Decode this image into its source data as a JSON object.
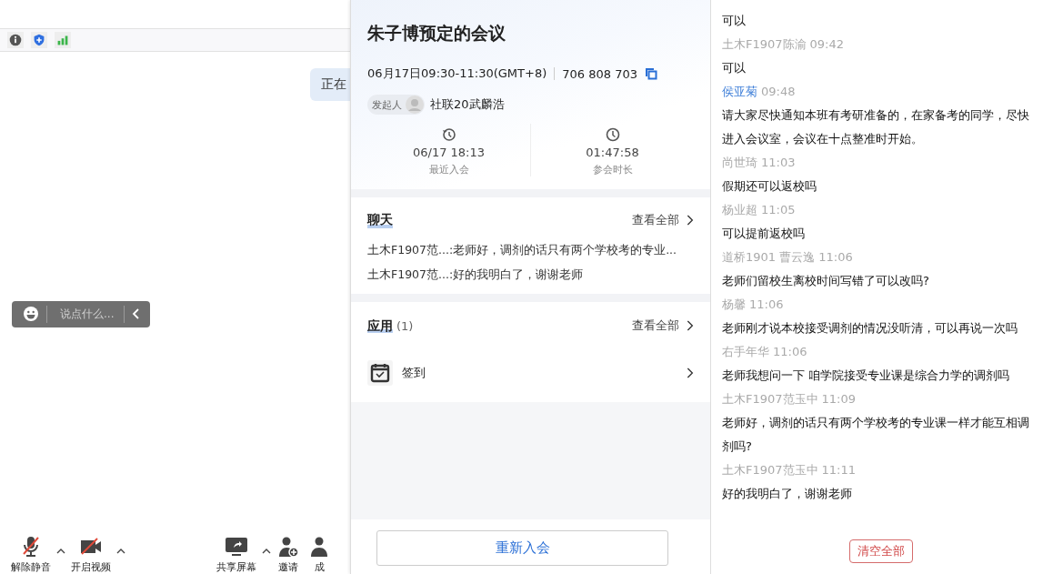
{
  "meeting_view": {
    "status_bubble": "正在",
    "chat_input": {
      "placeholder": "说点什么..."
    },
    "toolbar": [
      {
        "label": "解除静音",
        "kind": "mic",
        "caret": true
      },
      {
        "label": "开启视频",
        "kind": "video",
        "caret": true
      },
      {
        "label": "共享屏幕",
        "kind": "share",
        "caret": true
      },
      {
        "label": "邀请",
        "kind": "invite",
        "caret": false
      },
      {
        "label": "成",
        "kind": "members",
        "caret": false
      }
    ]
  },
  "meeting_panel": {
    "title": "朱子博预定的会议",
    "time": "06月17日09:30-11:30(GMT+8)",
    "meeting_id": "706 808 703",
    "organizer_tag": "发起人",
    "organizer": "社联20武麟浩",
    "stats": [
      {
        "kind": "recent",
        "value": "06/17 18:13",
        "label": "最近入会"
      },
      {
        "kind": "duration",
        "value": "01:47:58",
        "label": "参会时长"
      }
    ],
    "chat": {
      "title": "聊天",
      "view_all": "查看全部",
      "previews": [
        "土木F1907范...:老师好，调剂的话只有两个学校考的专业...",
        "土木F1907范...:好的我明白了，谢谢老师"
      ]
    },
    "apps": {
      "title": "应用",
      "count": "(1)",
      "view_all": "查看全部",
      "items": [
        {
          "label": "签到"
        }
      ]
    },
    "rejoin_button": "重新入会"
  },
  "chat_log": {
    "messages": [
      {
        "kind": "text",
        "text": "可以"
      },
      {
        "kind": "sender",
        "host": false,
        "name": "土木F1907陈渝",
        "time": "09:42"
      },
      {
        "kind": "text",
        "text": "可以"
      },
      {
        "kind": "sender",
        "host": true,
        "name": "侯亚菊",
        "time": "09:48"
      },
      {
        "kind": "text",
        "text": "请大家尽快通知本班有考研准备的，在家备考的同学，尽快进入会议室，会议在十点整准时开始。"
      },
      {
        "kind": "sender",
        "host": false,
        "name": "尚世琦",
        "time": "11:03"
      },
      {
        "kind": "text",
        "text": "假期还可以返校吗"
      },
      {
        "kind": "sender",
        "host": false,
        "name": "杨业超",
        "time": "11:05"
      },
      {
        "kind": "text",
        "text": "可以提前返校吗"
      },
      {
        "kind": "sender",
        "host": false,
        "name": "道桥1901 曹云逸",
        "time": "11:06"
      },
      {
        "kind": "text",
        "text": "老师们留校生离校时间写错了可以改吗?"
      },
      {
        "kind": "sender",
        "host": false,
        "name": "杨馨",
        "time": "11:06"
      },
      {
        "kind": "text",
        "text": "老师刚才说本校接受调剂的情况没听清，可以再说一次吗"
      },
      {
        "kind": "sender",
        "host": false,
        "name": "右手年华",
        "time": "11:06"
      },
      {
        "kind": "text",
        "text": "老师我想问一下 咱学院接受专业课是综合力学的调剂吗"
      },
      {
        "kind": "sender",
        "host": false,
        "name": "土木F1907范玉中",
        "time": "11:09"
      },
      {
        "kind": "text",
        "text": "老师好，调剂的话只有两个学校考的专业课一样才能互相调剂吗?"
      },
      {
        "kind": "sender",
        "host": false,
        "name": "土木F1907范玉中",
        "time": "11:11"
      },
      {
        "kind": "text",
        "text": "好的我明白了，谢谢老师"
      }
    ],
    "clear_button": "清空全部"
  }
}
